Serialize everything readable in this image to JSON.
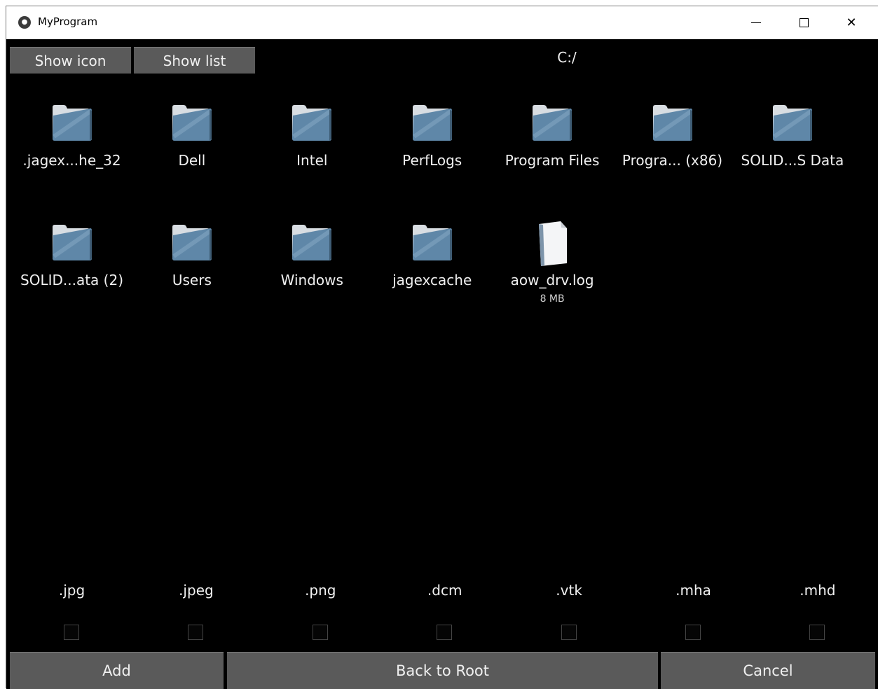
{
  "window": {
    "title": "MyProgram",
    "app_icon": "kivy-logo-icon",
    "controls": {
      "minimize": "minimize-icon",
      "maximize": "maximize-icon",
      "close_label": "✕"
    }
  },
  "toolbar": {
    "show_icon_label": "Show icon",
    "show_list_label": "Show list",
    "current_path": "C:/"
  },
  "files": [
    {
      "name": ".jagex...he_32",
      "type": "folder",
      "size": ""
    },
    {
      "name": "Dell",
      "type": "folder",
      "size": ""
    },
    {
      "name": "Intel",
      "type": "folder",
      "size": ""
    },
    {
      "name": "PerfLogs",
      "type": "folder",
      "size": ""
    },
    {
      "name": "Program Files",
      "type": "folder",
      "size": ""
    },
    {
      "name": "Progra... (x86)",
      "type": "folder",
      "size": ""
    },
    {
      "name": "SOLID...S Data",
      "type": "folder",
      "size": ""
    },
    {
      "name": "SOLID...ata (2)",
      "type": "folder",
      "size": ""
    },
    {
      "name": "Users",
      "type": "folder",
      "size": ""
    },
    {
      "name": "Windows",
      "type": "folder",
      "size": ""
    },
    {
      "name": "jagexcache",
      "type": "folder",
      "size": ""
    },
    {
      "name": "aow_drv.log",
      "type": "file",
      "size": "8 MB"
    }
  ],
  "filters": [
    {
      "label": ".jpg",
      "checked": false
    },
    {
      "label": ".jpeg",
      "checked": false
    },
    {
      "label": ".png",
      "checked": false
    },
    {
      "label": ".dcm",
      "checked": false
    },
    {
      "label": ".vtk",
      "checked": false
    },
    {
      "label": ".mha",
      "checked": false
    },
    {
      "label": ".mhd",
      "checked": false
    }
  ],
  "actions": {
    "add_label": "Add",
    "back_to_root_label": "Back to Root",
    "cancel_label": "Cancel"
  },
  "colors": {
    "background": "#000000",
    "button": "#5a5a5a",
    "text": "#f0f0f0",
    "folder_front": "#5f87a8",
    "folder_back": "#d8dde2"
  }
}
